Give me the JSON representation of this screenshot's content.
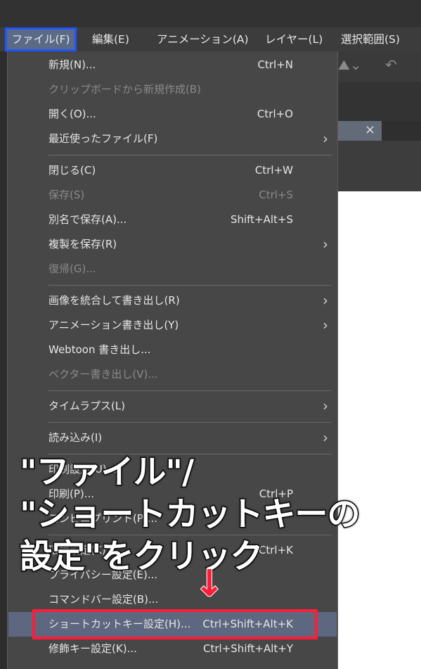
{
  "menubar": {
    "items": [
      {
        "label": "ファイル(F)"
      },
      {
        "label": "編集(E)"
      },
      {
        "label": "アニメーション(A)"
      },
      {
        "label": "レイヤー(L)"
      },
      {
        "label": "選択範囲(S)"
      }
    ]
  },
  "file_menu": {
    "items": [
      {
        "label": "新規(N)...",
        "shortcut": "Ctrl+N"
      },
      {
        "label": "クリップボードから新規作成(B)",
        "disabled": true
      },
      {
        "label": "開く(O)...",
        "shortcut": "Ctrl+O"
      },
      {
        "label": "最近使ったファイル(F)",
        "submenu": true
      },
      {
        "label": "閉じる(C)",
        "shortcut": "Ctrl+W"
      },
      {
        "label": "保存(S)",
        "shortcut": "Ctrl+S",
        "disabled": true
      },
      {
        "label": "別名で保存(A)...",
        "shortcut": "Shift+Alt+S"
      },
      {
        "label": "複製を保存(R)",
        "submenu": true
      },
      {
        "label": "復帰(G)...",
        "disabled": true
      },
      {
        "label": "画像を統合して書き出し(R)",
        "submenu": true
      },
      {
        "label": "アニメーション書き出し(Y)",
        "submenu": true
      },
      {
        "label": "Webtoon 書き出し..."
      },
      {
        "label": "ベクター書き出し(V)...",
        "disabled": true
      },
      {
        "label": "タイムラプス(L)",
        "submenu": true
      },
      {
        "label": "読み込み(I)",
        "submenu": true
      },
      {
        "label": "印刷設定(U)..."
      },
      {
        "label": "印刷(P)...",
        "shortcut": "Ctrl+P"
      },
      {
        "label": "コンビニプリント(P)..."
      },
      {
        "label": "環境設定(K)...",
        "shortcut": "Ctrl+K"
      },
      {
        "label": "プライバシー設定(E)..."
      },
      {
        "label": "コマンドバー設定(B)..."
      },
      {
        "label": "ショートカットキー設定(H)...",
        "shortcut": "Ctrl+Shift+Alt+K",
        "highlighted": true
      },
      {
        "label": "修飾キー設定(K)...",
        "shortcut": "Ctrl+Shift+Alt+Y"
      }
    ]
  },
  "annotation": {
    "line1": "\"ファイル\"/",
    "line2": "\"ショートカットキーの",
    "line3": "設定\"をクリック",
    "arrow": "↓"
  },
  "colors": {
    "highlight_box": "#1f55ff",
    "red_box": "#ff1c38",
    "menu_bg": "#474747",
    "highlight_row": "#5e6780"
  },
  "icons": {
    "submenu": "chevron-right-icon",
    "close": "close-icon",
    "undo": "undo-icon"
  },
  "tab": {
    "close": "×"
  }
}
